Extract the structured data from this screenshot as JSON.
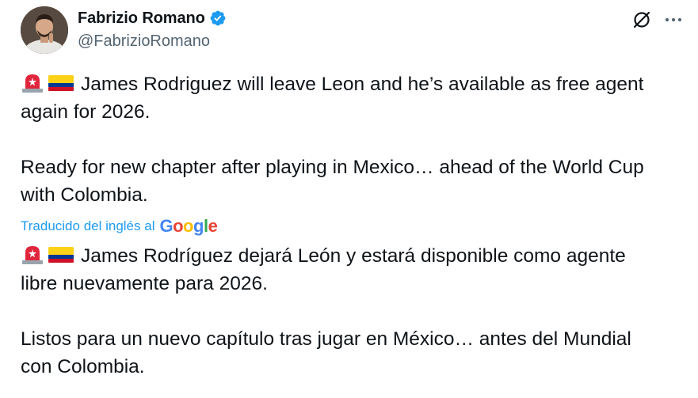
{
  "author": {
    "display_name": "Fabrizio Romano",
    "handle": "@FabrizioRomano",
    "verified": true
  },
  "icons": {
    "verified": "verified-badge-icon",
    "grok": "grok-icon",
    "more": "more-options-icon",
    "siren": "police-light-emoji",
    "flag": "colombia-flag-emoji"
  },
  "colors": {
    "verified_badge": "#1d9bf0",
    "link": "#1d9bf0",
    "secondary_text": "#536471",
    "primary_text": "#0f1419"
  },
  "tweet": {
    "original_line1": "James Rodriguez will leave Leon and he’s available as free agent",
    "original_line2": "again for 2026.",
    "original_line3": "Ready for new chapter after playing in Mexico… ahead of the World Cup",
    "original_line4": "with Colombia.",
    "translated_line1": "James Rodríguez dejará León y estará disponible como agente",
    "translated_line2": "libre nuevamente para 2026.",
    "translated_line3": "Listos para un nuevo capítulo tras jugar en México… antes del Mundial",
    "translated_line4": "con Colombia."
  },
  "translation": {
    "label": "Traducido del inglés al",
    "provider": "Google"
  }
}
